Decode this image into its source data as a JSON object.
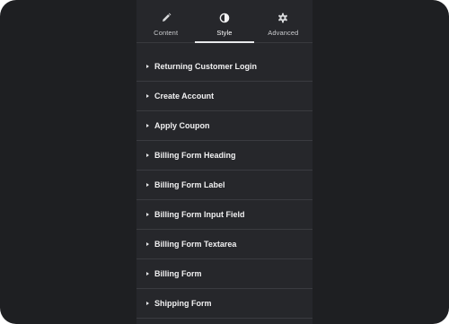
{
  "tabs": [
    {
      "label": "Content",
      "icon": "pencil-icon",
      "active": false
    },
    {
      "label": "Style",
      "icon": "contrast-circle-icon",
      "active": true
    },
    {
      "label": "Advanced",
      "icon": "gear-icon",
      "active": false
    }
  ],
  "sections": [
    {
      "title": "Returning Customer Login"
    },
    {
      "title": "Create Account"
    },
    {
      "title": "Apply Coupon"
    },
    {
      "title": "Billing Form Heading"
    },
    {
      "title": "Billing Form Label"
    },
    {
      "title": "Billing Form Input Field"
    },
    {
      "title": "Billing Form Textarea"
    },
    {
      "title": "Billing Form"
    },
    {
      "title": "Shipping Form"
    }
  ],
  "colors": {
    "background": "#1e1f22",
    "panel": "#26272b",
    "text": "#f1f1f2",
    "divider": "#3a3b40"
  }
}
